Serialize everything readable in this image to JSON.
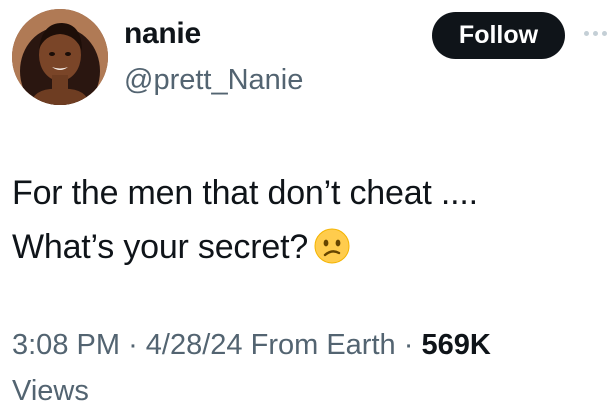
{
  "author": {
    "display_name": "nanie",
    "handle": "@prett_Nanie",
    "avatar_icon": "profile-photo"
  },
  "follow_label": "Follow",
  "more_icon": "ellipsis-icon",
  "tweet": {
    "line1": "For the men that don’t cheat ....",
    "line2": "What’s your secret?",
    "emoji": "confused-face-emoji"
  },
  "meta": {
    "time": "3:08 PM",
    "separator": "·",
    "date": "4/28/24",
    "source": "From Earth",
    "views_count": "569K",
    "views_label": "Views"
  },
  "colors": {
    "text": "#0f1419",
    "secondary": "#536471",
    "button_bg": "#0f1419",
    "button_text": "#ffffff"
  }
}
